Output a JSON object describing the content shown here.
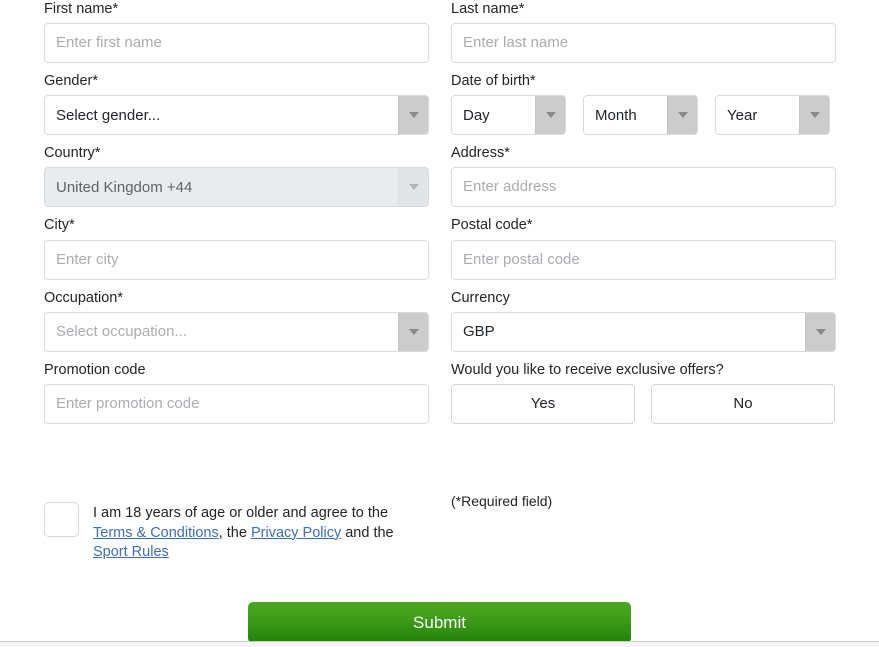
{
  "form": {
    "fields": {
      "first_name": {
        "label": "First name*",
        "placeholder": "Enter first name",
        "value": ""
      },
      "last_name": {
        "label": "Last name*",
        "placeholder": "Enter last name",
        "value": ""
      },
      "gender": {
        "label": "Gender*",
        "value": "Select gender..."
      },
      "dob": {
        "label": "Date of birth*",
        "day": "Day",
        "month": "Month",
        "year": "Year"
      },
      "country": {
        "label": "Country*",
        "value": "United Kingdom +44",
        "state": "disabled"
      },
      "address": {
        "label": "Address*",
        "placeholder": "Enter address",
        "value": ""
      },
      "city": {
        "label": "City*",
        "placeholder": "Enter city",
        "value": ""
      },
      "postal_code": {
        "label": "Postal code*",
        "placeholder": "Enter postal code",
        "value": ""
      },
      "occupation": {
        "label": "Occupation*",
        "value": "Select occupation..."
      },
      "currency": {
        "label": "Currency",
        "value": "GBP"
      },
      "promotion_code": {
        "label": "Promotion code",
        "placeholder": "Enter promotion code",
        "value": ""
      },
      "exclusive_offers": {
        "label": "Would you like to receive exclusive offers?",
        "yes_label": "Yes",
        "no_label": "No"
      }
    },
    "terms": {
      "text_part_1": "I am 18 years of age or older and agree to the ",
      "link_terms": "Terms & Conditions",
      "text_part_2": ", the ",
      "link_privacy": "Privacy Policy",
      "text_part_3": " and the ",
      "link_sport_rules": "Sport Rules"
    },
    "required_note": "(*Required field)",
    "submit_label": "Submit"
  },
  "colors": {
    "submit_green_top": "#4aa81f",
    "submit_green_bottom": "#1f8209",
    "link_blue": "#3b6fb6",
    "placeholder_gray": "#a9acb0",
    "disabled_bg": "#e9ecef",
    "select_arrow_bg": "#cccccc"
  }
}
